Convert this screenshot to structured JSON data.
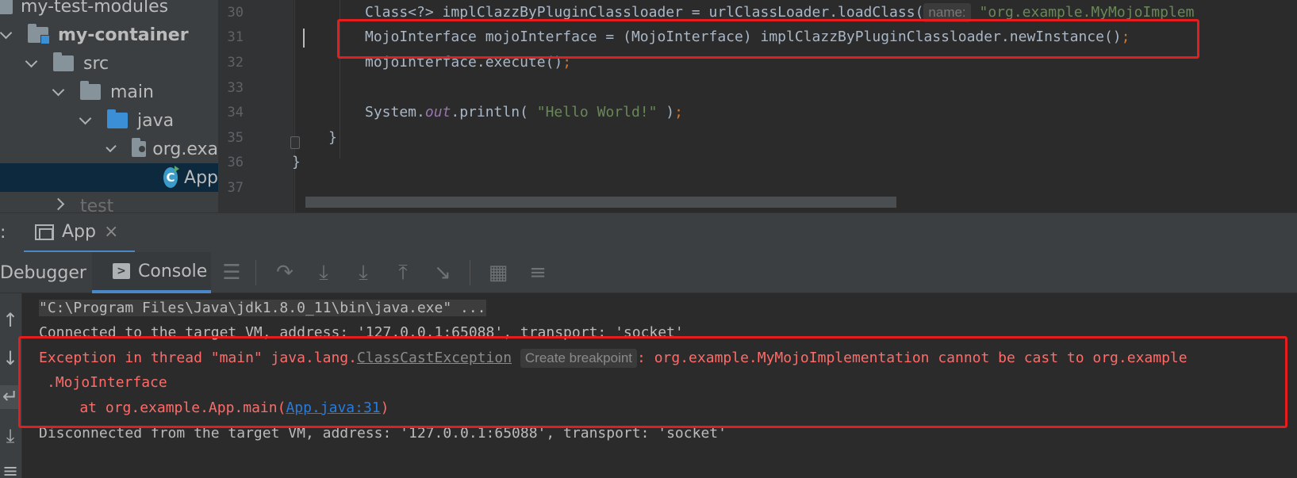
{
  "project_tree": {
    "items": [
      {
        "label": "my-test-modules"
      },
      {
        "label": "my-container"
      },
      {
        "label": "src"
      },
      {
        "label": "main"
      },
      {
        "label": "java"
      },
      {
        "label": "org.exa"
      },
      {
        "label": "App"
      },
      {
        "label": "test"
      }
    ]
  },
  "editor": {
    "line_numbers": [
      "30",
      "31",
      "32",
      "33",
      "34",
      "35",
      "36",
      "37"
    ],
    "line30": {
      "prefix": "Class<?> implClazzByPluginClassloader = urlClassLoader.loadClass(",
      "hint": "name:",
      "string": "\"org.example.MyMojoImplem"
    },
    "line31": {
      "text": "MojoInterface mojoInterface = (MojoInterface) implClazzByPluginClassloader.newInstance()",
      "semi": ";"
    },
    "line32": {
      "text": "mojoInterface.execute()",
      "semi": ";"
    },
    "line34": {
      "prefix": "System.",
      "field": "out",
      "call": ".println( ",
      "string": "\"Hello World!\"",
      "close": " )",
      "semi": ";"
    },
    "line35": {
      "text": "}"
    },
    "line36": {
      "text": "}"
    }
  },
  "run_window": {
    "colon": ":",
    "tab_label": "App",
    "close_glyph": "×",
    "tabs": {
      "debugger": "Debugger",
      "console": "Console"
    }
  },
  "console": {
    "cmd": "\"C:\\Program Files\\Java\\jdk1.8.0_11\\bin\\java.exe\" ...",
    "connected": "Connected to the target VM, address: '127.0.0.1:65088', transport: 'socket'",
    "exception": {
      "prefix": "Exception in thread \"main\" java.lang.",
      "exc_name": "ClassCastException",
      "hint": "Create breakpoint",
      "message": ": org.example.MyMojoImplementation cannot be cast to org.example"
    },
    "exception_cont": ".MojoInterface",
    "stack": {
      "prefix": "    at org.example.App.main(",
      "link": "App.java:31",
      "suffix": ")"
    },
    "disconnected": "Disconnected from the target VM, address: '127.0.0.1:65088', transport: 'socket'"
  },
  "colors": {
    "annotation_red": "#e41e1e",
    "error_text": "#ff6b68",
    "link_blue": "#287bde"
  }
}
